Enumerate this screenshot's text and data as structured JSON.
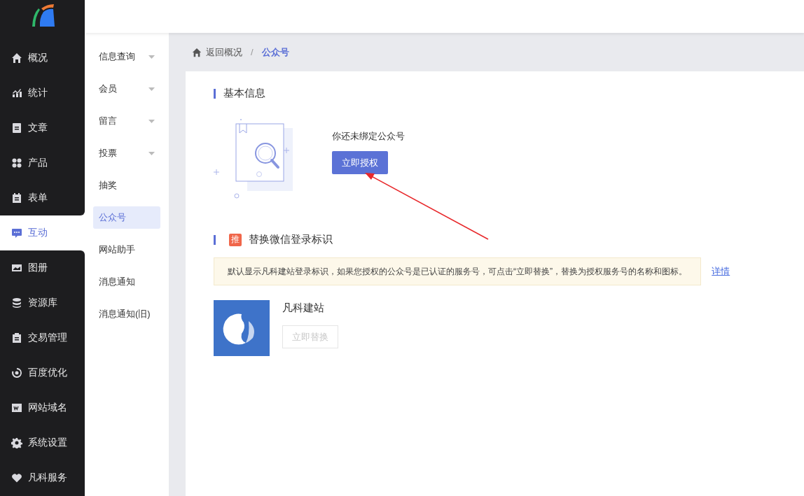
{
  "main_nav": [
    {
      "label": "概况",
      "selected": false
    },
    {
      "label": "统计",
      "selected": false
    },
    {
      "label": "文章",
      "selected": false
    },
    {
      "label": "产品",
      "selected": false
    },
    {
      "label": "表单",
      "selected": false
    },
    {
      "label": "互动",
      "selected": true
    },
    {
      "label": "图册",
      "selected": false
    },
    {
      "label": "资源库",
      "selected": false
    },
    {
      "label": "交易管理",
      "selected": false
    },
    {
      "label": "百度优化",
      "selected": false
    },
    {
      "label": "网站域名",
      "selected": false
    },
    {
      "label": "系统设置",
      "selected": false
    },
    {
      "label": "凡科服务",
      "selected": false
    }
  ],
  "sub_nav": [
    {
      "label": "信息查询",
      "kind": "group",
      "selected": false
    },
    {
      "label": "会员",
      "kind": "group",
      "selected": false
    },
    {
      "label": "留言",
      "kind": "group",
      "selected": false
    },
    {
      "label": "投票",
      "kind": "group",
      "selected": false
    },
    {
      "label": "抽奖",
      "kind": "link",
      "selected": false
    },
    {
      "label": "公众号",
      "kind": "link",
      "selected": true
    },
    {
      "label": "网站助手",
      "kind": "link",
      "selected": false
    },
    {
      "label": "消息通知",
      "kind": "link",
      "selected": false
    },
    {
      "label": "消息通知(旧)",
      "kind": "link",
      "selected": false
    }
  ],
  "breadcrumb": {
    "back": "返回概况",
    "separator": "/",
    "current": "公众号"
  },
  "basic_section": {
    "title": "基本信息",
    "message": "你还未绑定公众号",
    "button": "立即授权"
  },
  "replace_section": {
    "badge": "推",
    "title": "替换微信登录标识",
    "notice": "默认显示凡科建站登录标识，如果您授权的公众号是已认证的服务号，可点击“立即替换”，替换为授权服务号的名称和图标。",
    "details_link": "详情",
    "account_name": "凡科建站",
    "button": {
      "label": "立即替换",
      "disabled": true
    }
  }
}
